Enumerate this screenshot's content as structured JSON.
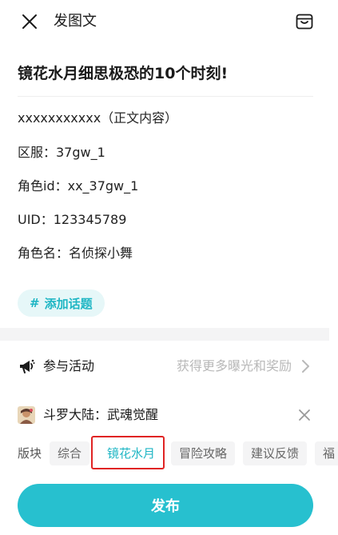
{
  "header": {
    "title": "发图文"
  },
  "post": {
    "title": "镜花水月细思极恐的10个时刻!",
    "body_lines": [
      "xxxxxxxxxxx（正文内容）",
      "区服：37gw_1",
      "角色id：xx_37gw_1",
      "UID：123345789",
      "角色名：名侦探小舞"
    ]
  },
  "topic": {
    "hash": "#",
    "label": "添加话题"
  },
  "activity": {
    "label": "参与活动",
    "hint": "获得更多曝光和奖励"
  },
  "game": {
    "name": "斗罗大陆：武魂觉醒"
  },
  "sections": {
    "label": "版块",
    "tabs": [
      {
        "label": "综合",
        "selected": false
      },
      {
        "label": "镜花水月",
        "selected": true
      },
      {
        "label": "冒险攻略",
        "selected": false
      },
      {
        "label": "建议反馈",
        "selected": false
      },
      {
        "label": "福",
        "selected": false
      }
    ]
  },
  "publish": {
    "label": "发布"
  },
  "colors": {
    "accent": "#27c0cf",
    "accent_text": "#1fb6c4",
    "highlight": "#e02424"
  },
  "icons": {
    "close": "close-icon",
    "draft": "draft-box-icon",
    "activity": "megaphone-icon",
    "chevron": "chevron-right-icon",
    "remove": "close-icon"
  }
}
